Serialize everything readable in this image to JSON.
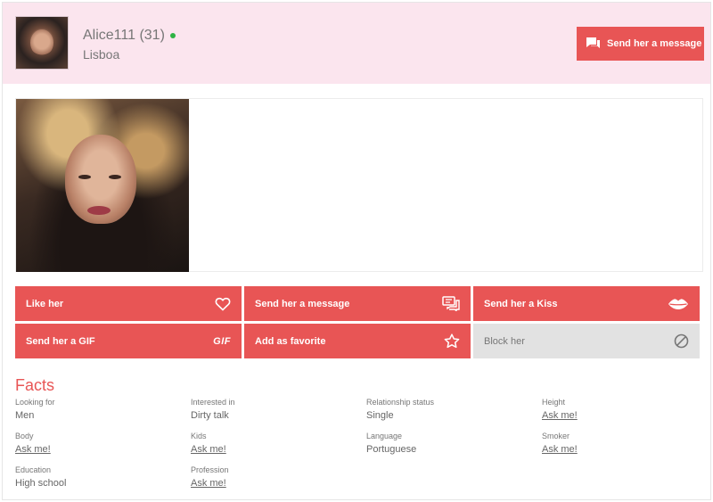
{
  "header": {
    "name": "Alice111",
    "age": "(31)",
    "city": "Lisboa",
    "message_button": "Send her a message"
  },
  "actions": [
    {
      "label": "Like her",
      "icon": "heart-icon",
      "style": "primary"
    },
    {
      "label": "Send her a message",
      "icon": "chat-bubbles-icon",
      "style": "primary"
    },
    {
      "label": "Send her a Kiss",
      "icon": "lips-icon",
      "style": "primary"
    },
    {
      "label": "Send her a GIF",
      "icon": "gif-icon",
      "icon_text": "GIF",
      "style": "primary"
    },
    {
      "label": "Add as favorite",
      "icon": "star-icon",
      "style": "primary"
    },
    {
      "label": "Block her",
      "icon": "block-icon",
      "style": "secondary"
    }
  ],
  "facts": {
    "title": "Facts",
    "items": [
      {
        "label": "Looking for",
        "value": "Men"
      },
      {
        "label": "Interested in",
        "value": "Dirty talk"
      },
      {
        "label": "Relationship status",
        "value": "Single"
      },
      {
        "label": "Height",
        "value": "Ask me!",
        "link": true
      },
      {
        "label": "Body",
        "value": "Ask me!",
        "link": true
      },
      {
        "label": "Kids",
        "value": "Ask me!",
        "link": true
      },
      {
        "label": "Language",
        "value": "Portuguese"
      },
      {
        "label": "Smoker",
        "value": "Ask me!",
        "link": true
      },
      {
        "label": "Education",
        "value": "High school"
      },
      {
        "label": "Profession",
        "value": "Ask me!",
        "link": true
      }
    ]
  },
  "colors": {
    "accent": "#e85555",
    "header_bg": "#fbe5ee",
    "online": "#2fb344",
    "disabled_bg": "#e2e2e2"
  }
}
